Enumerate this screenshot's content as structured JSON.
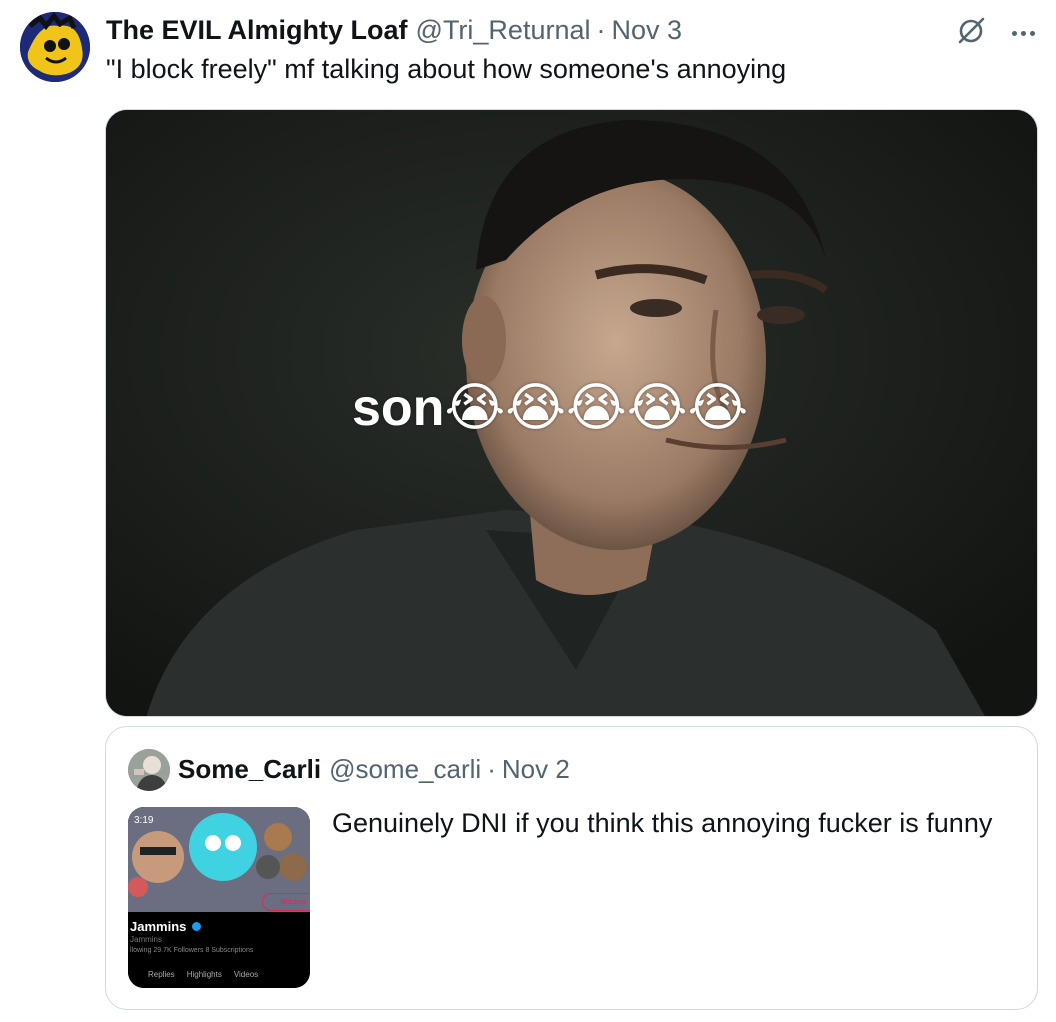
{
  "tweet": {
    "display_name": "The EVIL Almighty Loaf",
    "handle": "@Tri_Returnal",
    "separator": "·",
    "date": "Nov 3",
    "text": "\"I block freely\" mf talking about how someone's annoying",
    "media": {
      "caption": "son😭😭😭😭😭"
    }
  },
  "quoted_tweet": {
    "display_name": "Some_Carli",
    "handle": "@some_carli",
    "separator": "·",
    "date": "Nov 2",
    "text": "Genuinely DNI if you think this annoying fucker is funny",
    "thumbnail": {
      "time": "3:19",
      "profile_name": "Jammins",
      "profile_handle": "Jammins",
      "stats": "llowing  29.7K Followers  8 Subscriptions",
      "blocked_label": "Blocked",
      "tabs": [
        "Replies",
        "Highlights",
        "Videos"
      ]
    }
  },
  "icons": {
    "grok": "grok-icon",
    "more": "more-icon",
    "verified": "verified-badge-icon"
  },
  "colors": {
    "text_primary": "#0f1419",
    "text_secondary": "#536471",
    "border": "#cfd9de"
  }
}
